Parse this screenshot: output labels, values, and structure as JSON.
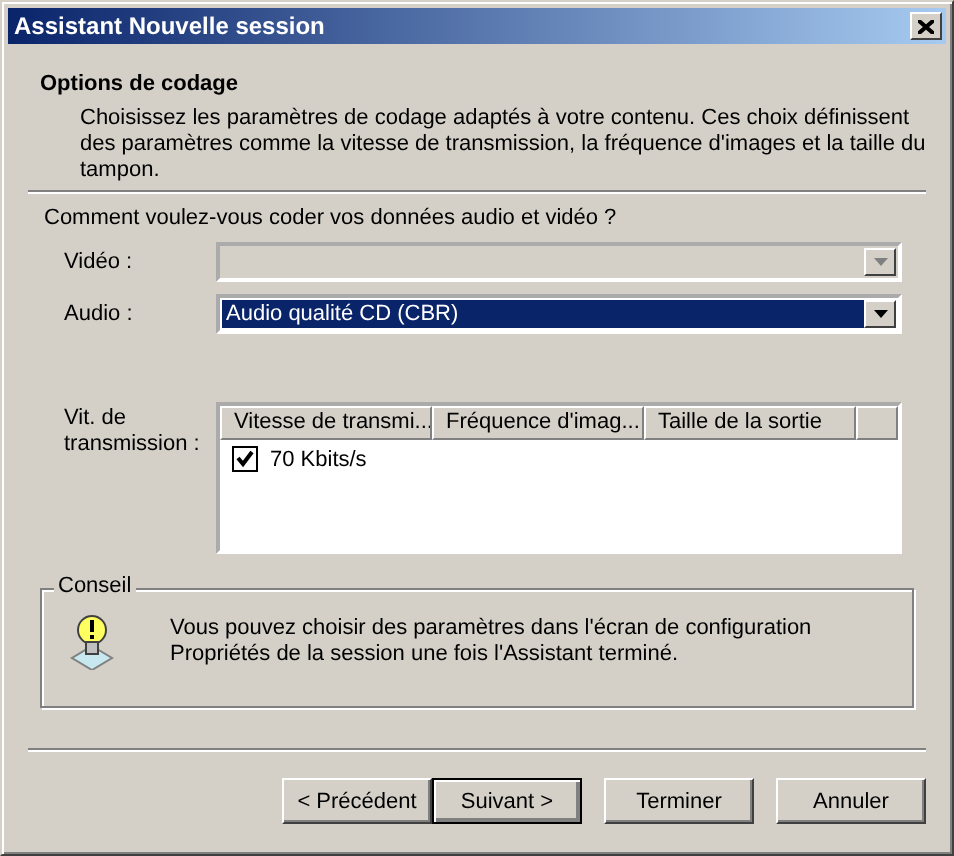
{
  "window": {
    "title": "Assistant Nouvelle session"
  },
  "header": {
    "title": "Options de codage",
    "description": "Choisissez les paramètres de codage adaptés à votre contenu. Ces choix définissent des paramètres comme la vitesse de transmission, la fréquence d'images et la taille du tampon."
  },
  "question": "Comment voulez-vous coder vos données audio et vidéo ?",
  "fields": [
    {
      "label": "Vidéo :",
      "disabled": true,
      "highlighted": false
    },
    {
      "label": "Audio :",
      "value": "Audio qualité CD (CBR)",
      "disabled": false,
      "highlighted": true
    }
  ],
  "bitrate": {
    "label": "Vit. de transmission :",
    "columns": [
      "Vitesse de transmi...",
      "Fréquence d'imag...",
      "Taille de la sortie"
    ],
    "rows": [
      {
        "cells": [
          "70 Kbits/s"
        ],
        "checked": true
      }
    ]
  },
  "tip": {
    "title": "Conseil",
    "text": "Vous pouvez choisir des paramètres dans l'écran de configuration\nPropriétés de la session une fois l'Assistant terminé."
  },
  "buttons": [
    {
      "label": "< Précédent",
      "default": false
    },
    {
      "label": "Suivant >",
      "default": true
    },
    {
      "label": "Terminer",
      "default": false
    },
    {
      "label": "Annuler",
      "default": false
    }
  ]
}
